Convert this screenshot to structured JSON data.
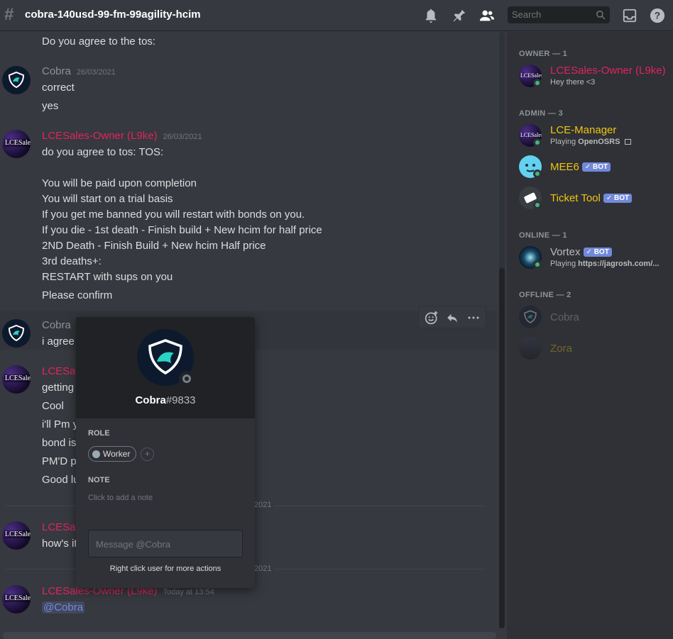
{
  "header": {
    "channel_name": "cobra-140usd-99-fm-99agility-hcim",
    "search_placeholder": "Search"
  },
  "messages": {
    "top_line": "Do you agree to the tos:",
    "m1": {
      "author": "Cobra",
      "time": "26/03/2021",
      "lines": [
        "correct",
        "yes"
      ]
    },
    "m2": {
      "author": "LCESales-Owner (L9ke)",
      "time": "26/03/2021",
      "lines": [
        "do you agree to tos: TOS:",
        "You will be paid upon completion",
        "You will start on a trial basis",
        "If you get me banned you will restart with bonds on you.",
        "If you die - 1st death - Finish build + New hcim for half price",
        "2ND Death - Finish Build + New hcim Half price",
        "3rd deaths+:",
        "RESTART with sups on you",
        "Please confirm"
      ]
    },
    "m3": {
      "author": "Cobra",
      "lines": [
        "i agree"
      ]
    },
    "m4": {
      "author": "LCESal",
      "lines": [
        "getting",
        "Cool",
        "i'll Pm y",
        "bond is",
        "PM'D p",
        "Good lu"
      ]
    },
    "divider1": "2021",
    "m5": {
      "author": "LCESal",
      "lines": [
        "how's it"
      ]
    },
    "divider2": "2021",
    "m6": {
      "author": "LCESales-Owner (L9ke)",
      "time": "Today at 13:54",
      "mention": "@Cobra"
    },
    "avatar_label": "LCESales"
  },
  "members": {
    "owner_header": "OWNER — 1",
    "owner": {
      "name": "LCESales-Owner (L9ke)",
      "status": "Hey there <3"
    },
    "admin_header": "ADMIN — 3",
    "admins": [
      {
        "name": "LCE-Manager",
        "activity_prefix": "Playing ",
        "activity": "OpenOSRS"
      },
      {
        "name": "MEE6",
        "badge": "✓ BOT"
      },
      {
        "name": "Ticket Tool",
        "badge": "✓ BOT"
      }
    ],
    "online_header": "ONLINE — 1",
    "online": [
      {
        "name": "Vortex",
        "badge": "✓ BOT",
        "activity_prefix": "Playing ",
        "activity": "https://jagrosh.com/..."
      }
    ],
    "offline_header": "OFFLINE — 2",
    "offline": [
      {
        "name": "Cobra"
      },
      {
        "name": "Zora"
      }
    ]
  },
  "popout": {
    "username": "Cobra",
    "discriminator": "#9833",
    "role_label": "ROLE",
    "role": "Worker",
    "role_add": "+",
    "note_label": "NOTE",
    "note_placeholder": "Click to add a note",
    "message_placeholder": "Message @Cobra",
    "hint": "Right click user for more actions"
  },
  "colors": {
    "owner": "#e0245e",
    "admin": "#f1c40f",
    "online": "#43b581",
    "mention": "#7289da"
  }
}
